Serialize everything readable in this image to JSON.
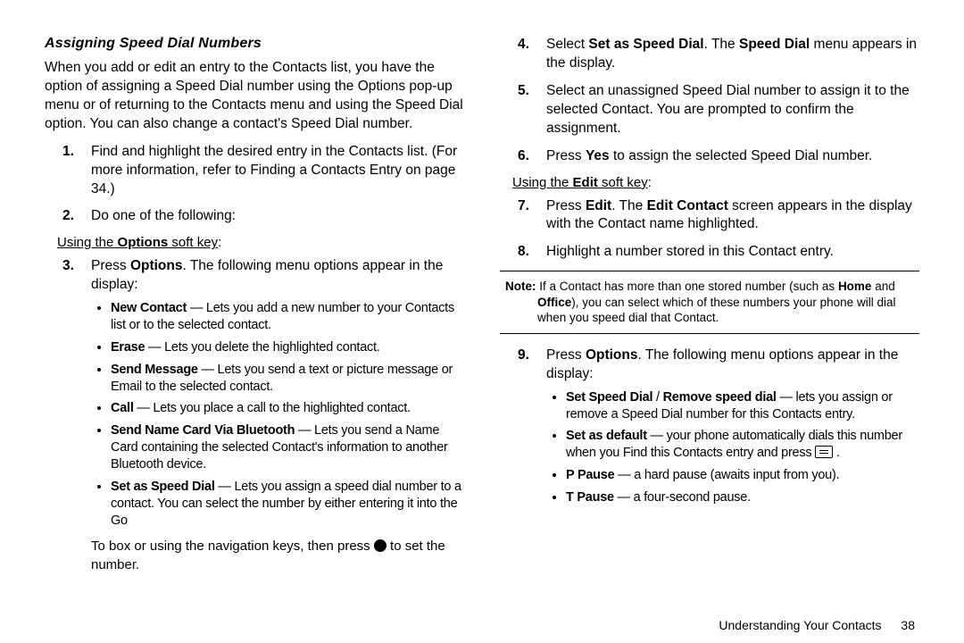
{
  "title": "Assigning Speed Dial Numbers",
  "intro": "When you add or edit an entry to the Contacts list, you have the option of assigning a Speed Dial number using the Options pop-up menu or of returning to the Contacts menu and using the Speed Dial option. You can also change a contact's Speed Dial number.",
  "steps": {
    "s1a": "Find and highlight the desired entry in the Contacts list. (For more information, refer to ",
    "s1link": "Finding a Contacts Entry",
    "s1b": " on page 34.)",
    "s2": "Do one of the following:",
    "s3a": "Press ",
    "s3b": ". The following menu options appear in the display:",
    "s4a": "Select ",
    "s4b": ". The ",
    "s4c": " menu appears in the display.",
    "s5": "Select an unassigned Speed Dial number to assign it to the selected Contact. You are prompted to confirm the assignment.",
    "s6a": "Press ",
    "s6b": " to assign the selected Speed Dial number.",
    "s7a": "Press ",
    "s7b": ". The ",
    "s7c": " screen appears in the display with the Contact name highlighted.",
    "s8": "Highlight a number stored in this Contact entry.",
    "s9a": "Press ",
    "s9b": ". The following menu options appear in the display:",
    "cont": "To box or using the navigation keys, then press ",
    "cont2": " to set the number."
  },
  "labels": {
    "options": "Options",
    "set_speed_dial": "Set as Speed Dial",
    "speed_dial": "Speed Dial",
    "yes": "Yes",
    "edit": "Edit",
    "edit_contact": "Edit Contact"
  },
  "sub_options": {
    "prefix": "Using the ",
    "options": "Options",
    "edit": "Edit",
    "suffix": " soft key"
  },
  "bullets1": {
    "b1t": "New Contact",
    "b1d": " — Lets you add a new number to your Contacts list or to the selected contact.",
    "b2t": "Erase",
    "b2d": " — Lets you delete the highlighted contact.",
    "b3t": "Send Message",
    "b3d": " — Lets you send a text or picture message or Email to the selected contact.",
    "b4t": "Call",
    "b4d": " — Lets you place a call to the highlighted contact.",
    "b5t": "Send Name Card Via Bluetooth",
    "b5d": " — Lets you send a Name Card containing the selected Contact's information to another Bluetooth device.",
    "b6t": "Set as Speed Dial",
    "b6d": " — Lets you assign a speed dial number to a contact. You can select the number by either entering it into the Go"
  },
  "bullets2": {
    "b1t": "Set Speed Dial",
    "b1sep": " / ",
    "b1t2": "Remove speed dial",
    "b1d": " — lets you assign or remove a Speed Dial number for this Contacts entry.",
    "b2t": "Set as default",
    "b2d": " — your phone automatically dials this number when you Find this Contacts entry and press ",
    "b2end": " .",
    "b3t": "P Pause",
    "b3d": " — a hard pause (awaits input from you).",
    "b4t": "T Pause",
    "b4d": " — a four-second pause."
  },
  "note": {
    "prefix": "Note:",
    "t1": " If a Contact has more than one stored number (such as ",
    "home": "Home",
    "t2": " and ",
    "office": "Office",
    "t3": "), you can select which of these numbers your phone will dial when you speed dial that Contact."
  },
  "footer": {
    "section": "Understanding Your Contacts",
    "page": "38"
  }
}
